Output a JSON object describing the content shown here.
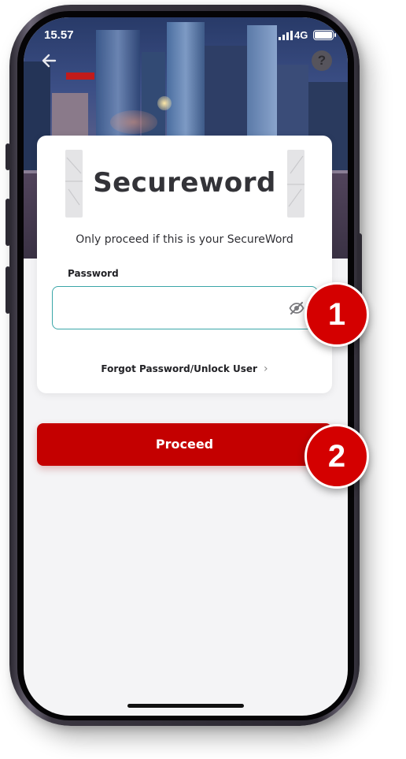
{
  "status_bar": {
    "time": "15.57",
    "network": "4G"
  },
  "card": {
    "secureword": "Secureword",
    "confirm_text": "Only proceed if this is your SecureWord",
    "password_label": "Password",
    "password_value": "",
    "forgot_link": "Forgot Password/Unlock User"
  },
  "proceed_button": {
    "label": "Proceed"
  },
  "callouts": {
    "first": "1",
    "second": "2"
  },
  "colors": {
    "brand_red": "#c40000",
    "field_border": "#3aa6a8",
    "screen_bg": "#f4f4f6"
  },
  "icons": [
    "back-arrow-icon",
    "help-icon",
    "eye-slash-icon",
    "chevron-right-icon",
    "signal-icon",
    "battery-icon"
  ]
}
